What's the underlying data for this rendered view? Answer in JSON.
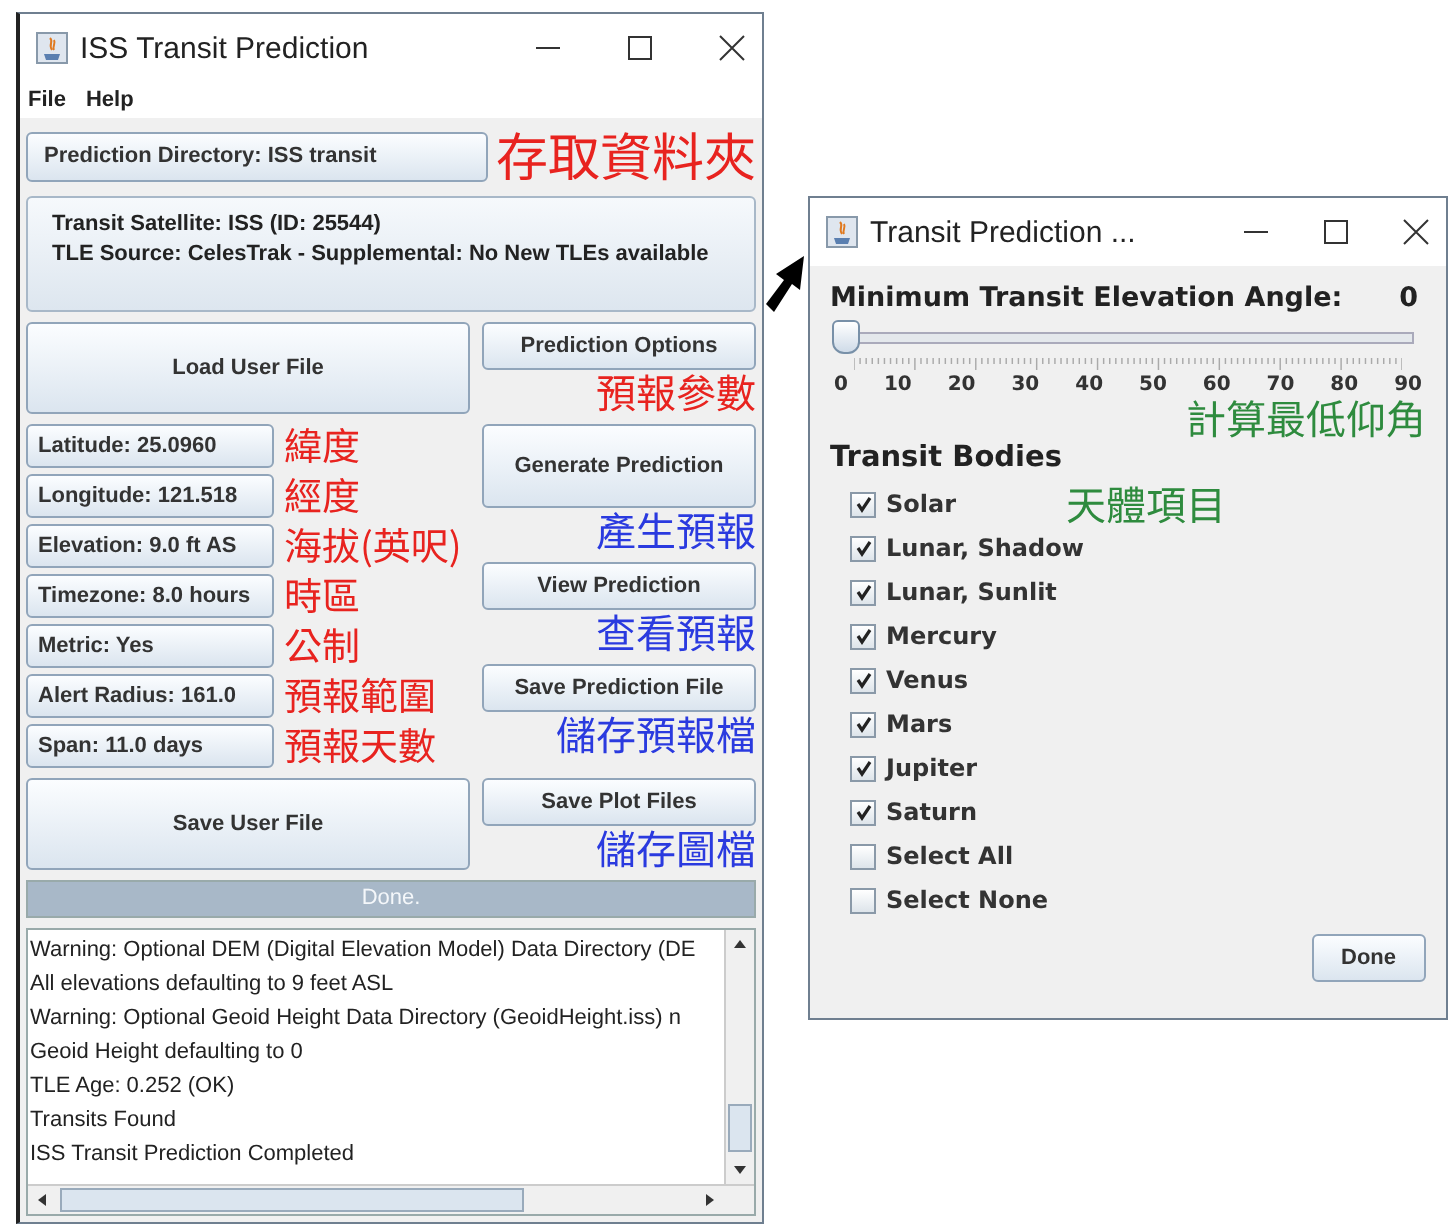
{
  "main_window": {
    "title": "ISS Transit Prediction",
    "menu": [
      "File",
      "Help"
    ],
    "directory_button": {
      "label": "Prediction Directory: ISS transit",
      "annotation": {
        "text": "存取資料夾",
        "color": "#e8231f"
      }
    },
    "satellite_info": [
      "Transit Satellite: ISS (ID: 25544)",
      "TLE Source: CelesTrak - Supplemental: No New TLEs available"
    ],
    "top_row": [
      {
        "label": "Load User File"
      },
      {
        "label": "Prediction Options",
        "annotation": {
          "text": "預報參數",
          "color": "#e8231f"
        }
      }
    ],
    "settings": [
      {
        "label": "Latitude: 25.0960",
        "annotation": {
          "text": "緯度",
          "color": "#e8231f"
        }
      },
      {
        "label": "Longitude: 121.518",
        "annotation": {
          "text": "經度",
          "color": "#e8231f"
        }
      },
      {
        "label": "Elevation: 9.0 ft AS",
        "annotation": {
          "text": "海拔(英呎)",
          "color": "#e8231f"
        }
      },
      {
        "label": "Timezone: 8.0 hours",
        "annotation": {
          "text": "時區",
          "color": "#e8231f"
        }
      },
      {
        "label": "Metric: Yes",
        "annotation": {
          "text": "公制",
          "color": "#e8231f"
        }
      },
      {
        "label": "Alert Radius: 161.0",
        "annotation": {
          "text": "預報範圍",
          "color": "#e8231f"
        }
      },
      {
        "label": "Span: 11.0 days",
        "annotation": {
          "text": "預報天數",
          "color": "#e8231f"
        }
      }
    ],
    "actions": [
      {
        "label": "Generate Prediction",
        "annotation": {
          "text": "產生預報",
          "color": "#2a3adf"
        }
      },
      {
        "label": "View Prediction",
        "annotation": {
          "text": "查看預報",
          "color": "#2a3adf"
        }
      },
      {
        "label": "Save Prediction File",
        "annotation": {
          "text": "儲存預報檔",
          "color": "#2a3adf"
        }
      }
    ],
    "bottom_row": [
      {
        "label": "Save User File"
      },
      {
        "label": "Save Plot Files",
        "annotation": {
          "text": "儲存圖檔",
          "color": "#2a3adf"
        }
      }
    ],
    "progress": {
      "text": "Done.",
      "level": 1
    },
    "log": [
      "Warning: Optional DEM (Digital Elevation Model) Data Directory (DE",
      "All elevations defaulting to 9 feet ASL",
      "Warning: Optional Geoid Height Data Directory (GeoidHeight.iss) n",
      "Geoid Height defaulting to 0",
      "TLE Age:  0.252 (OK)",
      "Transits Found",
      "ISS Transit Prediction Completed"
    ]
  },
  "dialog": {
    "title": "Transit Prediction ...",
    "elevation": {
      "label": "Minimum Transit Elevation Angle:",
      "value": "0",
      "level": 0,
      "ticks": [
        "0",
        "10",
        "20",
        "30",
        "40",
        "50",
        "60",
        "70",
        "80",
        "90"
      ],
      "annotation": {
        "text": "計算最低仰角",
        "color": "#2e8b3e"
      }
    },
    "bodies_heading": "Transit Bodies",
    "bodies_annotation": {
      "text": "天體項目",
      "color": "#2e8b3e"
    },
    "bodies": [
      {
        "label": "Solar",
        "checked": true
      },
      {
        "label": "Lunar, Shadow",
        "checked": true
      },
      {
        "label": "Lunar, Sunlit",
        "checked": true
      },
      {
        "label": "Mercury",
        "checked": true
      },
      {
        "label": "Venus",
        "checked": true
      },
      {
        "label": "Mars",
        "checked": true
      },
      {
        "label": "Jupiter",
        "checked": true
      },
      {
        "label": "Saturn",
        "checked": true
      },
      {
        "label": "Select All",
        "checked": false
      },
      {
        "label": "Select None",
        "checked": false
      }
    ],
    "done_button": "Done"
  }
}
